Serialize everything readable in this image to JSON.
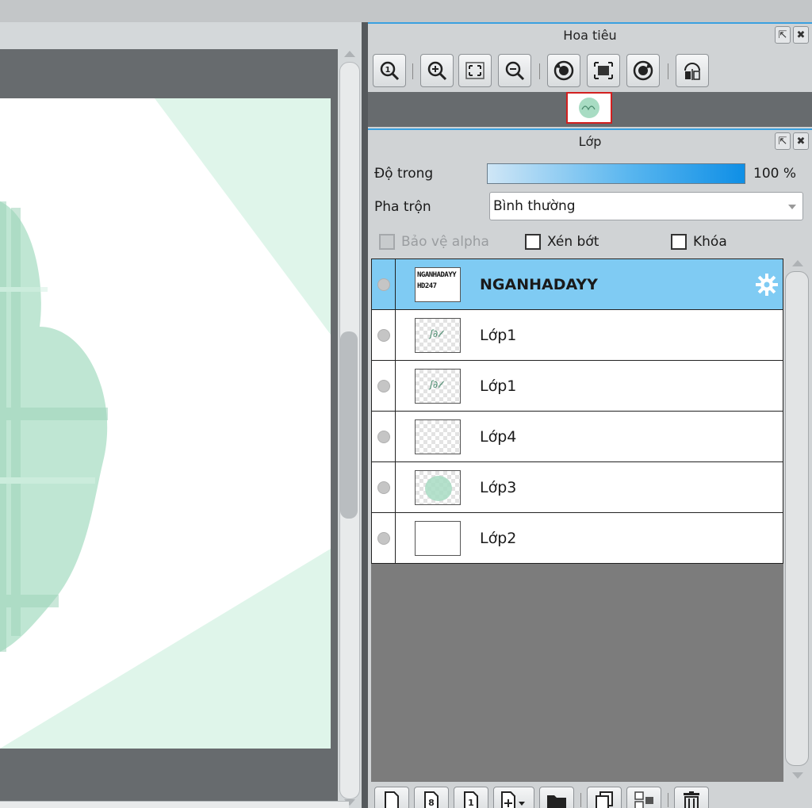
{
  "navigator": {
    "title": "Hoa tiêu",
    "toolbar": [
      {
        "icon": "zoom-actual-size-icon"
      },
      {
        "icon": "zoom-in-icon"
      },
      {
        "icon": "fit-to-window-icon"
      },
      {
        "icon": "zoom-out-icon"
      },
      {
        "icon": "rotate-left-icon"
      },
      {
        "icon": "reset-view-icon"
      },
      {
        "icon": "rotate-right-icon"
      },
      {
        "icon": "flip-horizontal-icon"
      }
    ]
  },
  "layers_panel": {
    "title": "Lớp",
    "opacity_label": "Độ trong",
    "opacity_value": "100 %",
    "opacity_fraction": 1.0,
    "blend_label": "Pha trộn",
    "blend_value": "Bình thường",
    "protect_alpha_label": "Bảo vệ alpha",
    "clipping_label": "Xén bớt",
    "lock_label": "Khóa",
    "layers": [
      {
        "name": "NGANHADAYY",
        "selected": true,
        "thumb_text_line1": "NGANHADAYY",
        "thumb_text_line2": "HD247"
      },
      {
        "name": "Lớp1",
        "selected": false
      },
      {
        "name": "Lớp1",
        "selected": false
      },
      {
        "name": "Lớp4",
        "selected": false
      },
      {
        "name": "Lớp3",
        "selected": false
      },
      {
        "name": "Lớp2",
        "selected": false
      }
    ],
    "footer_buttons": [
      {
        "icon": "new-layer-icon"
      },
      {
        "icon": "new-8bit-layer-icon"
      },
      {
        "icon": "new-1bit-layer-icon"
      },
      {
        "icon": "add-layer-dropdown-icon"
      },
      {
        "icon": "new-folder-icon"
      },
      {
        "icon": "duplicate-layer-icon"
      },
      {
        "icon": "merge-down-icon"
      },
      {
        "icon": "delete-layer-icon"
      }
    ]
  },
  "colors": {
    "accent_blue": "#3aa0e0",
    "selected_layer": "#7fcbf3",
    "canvas_mint": "#dff5ea",
    "shape_green": "#a8dcc3"
  }
}
